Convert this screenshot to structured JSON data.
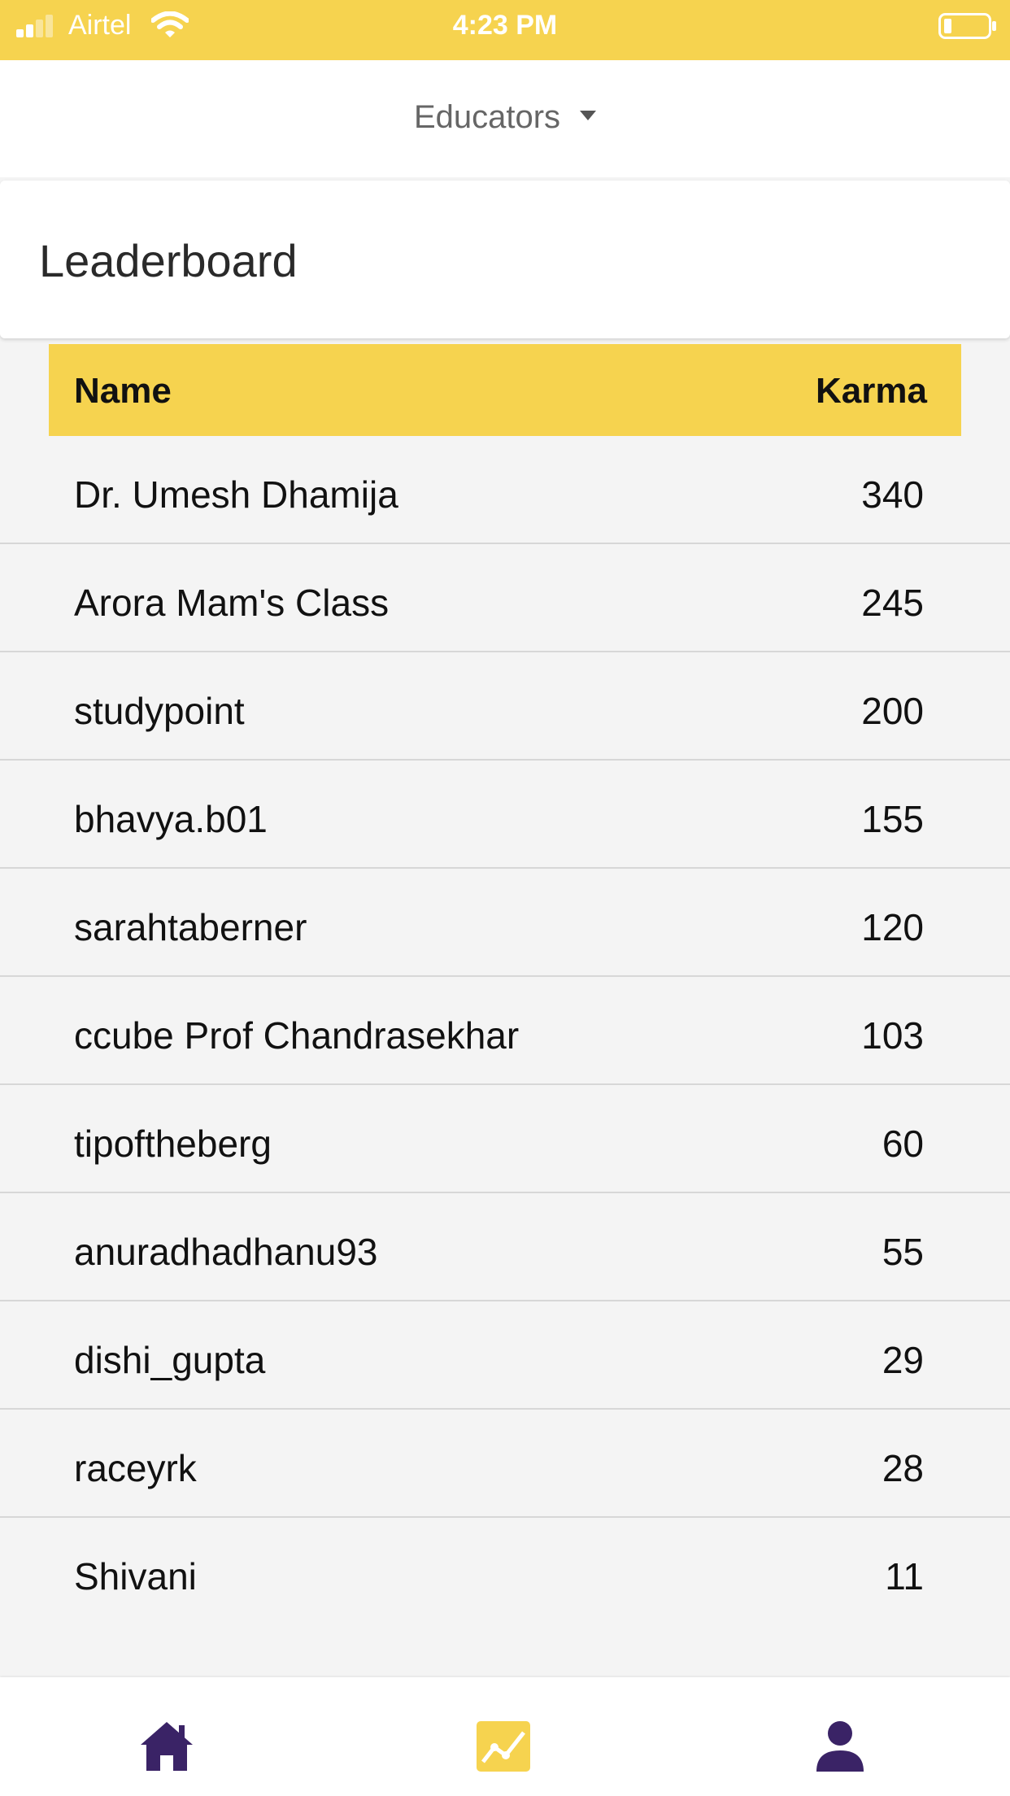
{
  "status_bar": {
    "carrier": "Airtel",
    "time": "4:23 PM"
  },
  "selector": {
    "value": "Educators"
  },
  "page": {
    "title": "Leaderboard"
  },
  "table": {
    "headers": {
      "name": "Name",
      "karma": "Karma"
    },
    "rows": [
      {
        "name": "Dr. Umesh Dhamija",
        "karma": "340"
      },
      {
        "name": "Arora Mam's Class",
        "karma": "245"
      },
      {
        "name": "studypoint",
        "karma": "200"
      },
      {
        "name": "bhavya.b01",
        "karma": "155"
      },
      {
        "name": "sarahtaberner",
        "karma": "120"
      },
      {
        "name": "ccube Prof Chandrasekhar",
        "karma": "103"
      },
      {
        "name": "tipoftheberg",
        "karma": "60"
      },
      {
        "name": "anuradhadhanu93",
        "karma": "55"
      },
      {
        "name": "dishi_gupta",
        "karma": "29"
      },
      {
        "name": "raceyrk",
        "karma": "28"
      },
      {
        "name": "Shivani",
        "karma": "11"
      }
    ]
  },
  "bottom_nav": {
    "items": [
      {
        "icon": "home-icon",
        "active": false
      },
      {
        "icon": "stats-icon",
        "active": true
      },
      {
        "icon": "profile-icon",
        "active": false
      }
    ]
  },
  "colors": {
    "accent_yellow": "#f6d34f",
    "nav_purple": "#3a2366",
    "row_background": "#f4f4f4"
  }
}
